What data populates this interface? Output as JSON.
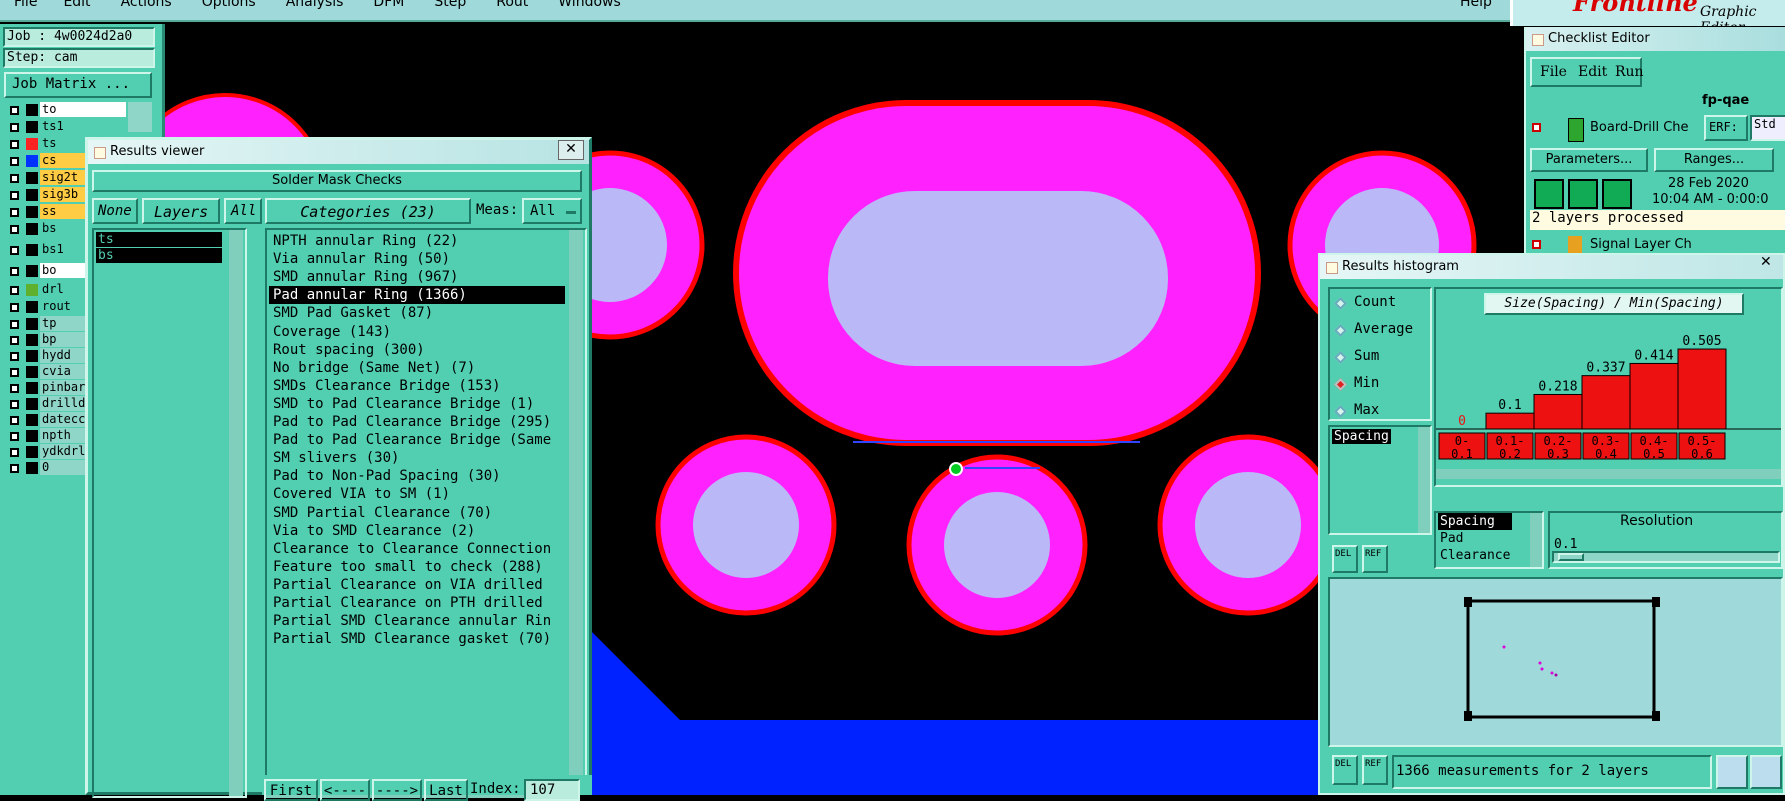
{
  "menubar": {
    "items": [
      "File",
      "Edit",
      "Actions",
      "Options",
      "Analysis",
      "DFM",
      "Step",
      "Rout",
      "Windows"
    ],
    "help": "Help"
  },
  "brand": {
    "logo": "Frontline",
    "subtitle": "Graphic Editor"
  },
  "job_panel": {
    "job": "Job : 4w0024d2a0",
    "step": "Step: cam",
    "matrix_button": "Job Matrix ...",
    "layers": [
      {
        "name": "to",
        "color": "#ffffff",
        "swatch": "#000000"
      },
      {
        "name": "ts1",
        "color": "#52ceb0",
        "swatch": "#000000"
      },
      {
        "name": "ts",
        "color": "#52ceb0",
        "swatch": "#ff2222"
      },
      {
        "name": "cs",
        "color": "#ffcc44",
        "swatch": "#0033ff"
      },
      {
        "name": "sig2t",
        "color": "#ffcc44",
        "swatch": "#000000"
      },
      {
        "name": "sig3b",
        "color": "#ffcc44",
        "swatch": "#000000"
      },
      {
        "name": "ss",
        "color": "#ffcc44",
        "swatch": "#000000"
      },
      {
        "name": "bs",
        "color": "#52ceb0",
        "swatch": "#000000"
      },
      {
        "name": "bs1",
        "color": "#52ceb0",
        "swatch": "#000000"
      },
      {
        "name": "bo",
        "color": "#ffffff",
        "swatch": "#000000"
      },
      {
        "name": "drl",
        "color": "#52ceb0",
        "swatch": "#60b030"
      },
      {
        "name": "rout",
        "color": "#52ceb0",
        "swatch": "#000000"
      },
      {
        "name": "tp",
        "color": "#8fd6c8",
        "swatch": "#000000"
      },
      {
        "name": "bp",
        "color": "#8fd6c8",
        "swatch": "#000000"
      },
      {
        "name": "hydd",
        "color": "#8fd6c8",
        "swatch": "#000000"
      },
      {
        "name": "cvia",
        "color": "#8fd6c8",
        "swatch": "#000000"
      },
      {
        "name": "pinbar",
        "color": "#8fd6c8",
        "swatch": "#000000"
      },
      {
        "name": "drilld",
        "color": "#8fd6c8",
        "swatch": "#000000"
      },
      {
        "name": "datecc",
        "color": "#8fd6c8",
        "swatch": "#000000"
      },
      {
        "name": "npth",
        "color": "#8fd6c8",
        "swatch": "#000000"
      },
      {
        "name": "ydkdrl",
        "color": "#8fd6c8",
        "swatch": "#000000"
      },
      {
        "name": "0",
        "color": "#8fd6c8",
        "swatch": "#000000"
      }
    ]
  },
  "results_viewer": {
    "title": "Results viewer",
    "header": "Solder Mask Checks",
    "none_button": "None",
    "layers_label": "Layers",
    "all_button": "All",
    "layers": [
      "ts",
      "bs"
    ],
    "categories_label": "Categories (23)",
    "meas_label": "Meas:",
    "meas_value": "All",
    "selected_index": 3,
    "categories": [
      "NPTH annular Ring (22)",
      "Via annular Ring (50)",
      "SMD annular Ring (967)",
      "Pad annular Ring (1366)",
      "SMD Pad Gasket (87)",
      "Coverage (143)",
      "Rout spacing (300)",
      "No bridge (Same Net) (7)",
      "SMDs Clearance Bridge (153)",
      "SMD to Pad Clearance Bridge (1)",
      "Pad to Pad Clearance Bridge (295)",
      "Pad to Pad Clearance Bridge (Same",
      "SM slivers (30)",
      "Pad to Non-Pad Spacing (30)",
      "Covered VIA to SM (1)",
      "SMD Partial Clearance (70)",
      "Via to SMD Clearance (2)",
      "Clearance to Clearance Connection",
      "Feature too small to check (288)",
      "Partial Clearance on VIA drilled",
      "Partial Clearance on PTH drilled",
      "Partial SMD Clearance annular Rin",
      "Partial SMD Clearance gasket (70)"
    ],
    "nav": {
      "first": "First",
      "prev": "<----",
      "next": "---->",
      "last": "Last",
      "index_label": "Index:",
      "index_value": "107"
    }
  },
  "checklist_editor": {
    "title": "Checklist Editor",
    "menu": [
      "File",
      "Edit",
      "Run"
    ],
    "checklist_name": "fp-qae",
    "item1": "Board-Drill Che",
    "erf": "ERF:",
    "std": "Std",
    "parameters": "Parameters...",
    "ranges": "Ranges...",
    "date": "28 Feb 2020",
    "time": "10:04 AM - 0:00:0",
    "status": "2 layers processed",
    "item2": "Signal Layer Ch",
    "sign": "sign"
  },
  "histogram": {
    "title": "Results histogram",
    "modes": [
      "Count",
      "Average",
      "Sum",
      "Min",
      "Max"
    ],
    "selected_mode": "Min",
    "list_item": "Spacing",
    "del": "DEL",
    "ref": "REF",
    "chart_title": "Size(Spacing) / Min(Spacing)",
    "range_labels": [
      [
        "0-",
        "0.1"
      ],
      [
        "0.1-",
        "0.2"
      ],
      [
        "0.2-",
        "0.3"
      ],
      [
        "0.3-",
        "0.4"
      ],
      [
        "0.4-",
        "0.5"
      ],
      [
        "0.5-",
        "0.6"
      ]
    ],
    "attrs": [
      "Spacing",
      "Pad",
      "Clearance"
    ],
    "resolution_label": "Resolution",
    "resolution_value": "0.1",
    "status": "1366 measurements for 2 layers"
  },
  "chart_data": {
    "type": "bar",
    "title": "Size(Spacing) / Min(Spacing)",
    "categories": [
      "0-0.1",
      "0.1-0.2",
      "0.2-0.3",
      "0.3-0.4",
      "0.4-0.5",
      "0.5-0.6"
    ],
    "values": [
      0,
      0.1,
      0.218,
      0.337,
      0.414,
      0.505
    ],
    "data_labels": [
      "0",
      "0.1",
      "0.218",
      "0.337",
      "0.414",
      "0.505"
    ],
    "bar_color": "#ee1111",
    "zero_label_color": "#ee1111"
  },
  "colors": {
    "teal": "#52ceb0",
    "pad_mask": "#ff22ff",
    "pad_copper": "#bbb8f8",
    "outline": "#ff0000",
    "board": "#0022ff"
  }
}
